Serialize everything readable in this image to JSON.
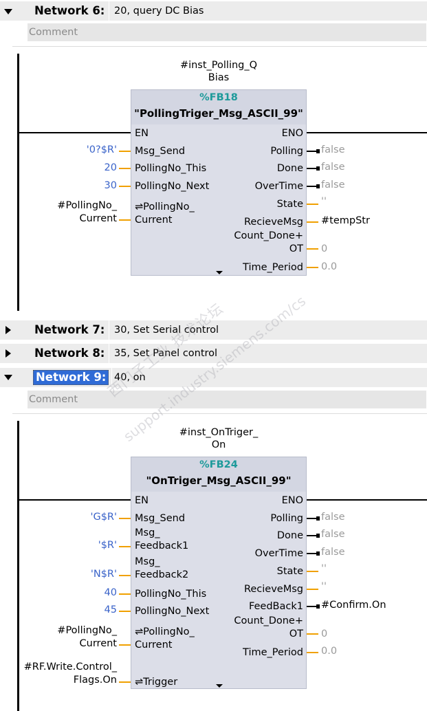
{
  "networks": [
    {
      "title": "Network 6:",
      "desc": "20, query DC Bias",
      "comment": "Comment"
    },
    {
      "title": "Network 7:",
      "desc": "30, Set Serial  control"
    },
    {
      "title": "Network 8:",
      "desc": "35, Set Panel control"
    },
    {
      "title": "Network 9:",
      "desc": "40, on",
      "comment": "Comment"
    }
  ],
  "fb1": {
    "inst_line1": "#inst_Polling_Q",
    "inst_line2": "Bias",
    "number": "%FB18",
    "name": "\"PollingTriger_Msg_ASCII_99\"",
    "in_en": "EN",
    "in_msg_send": "Msg_Send",
    "in_this": "PollingNo_This",
    "in_next": "PollingNo_Next",
    "in_cur1": "⇌PollingNo_",
    "in_cur2": "Current",
    "out_eno": "ENO",
    "out_polling": "Polling",
    "out_done": "Done",
    "out_overtime": "OverTime",
    "out_state": "State",
    "out_recieve": "RecieveMsg",
    "out_count1": "Count_Done+",
    "out_count2": "OT",
    "out_time": "Time_Period",
    "v_msg_send": "'0?$R'",
    "v_this": "20",
    "v_next": "30",
    "v_cur1": "#PollingNo_",
    "v_cur2": "Current",
    "v_polling": "false",
    "v_done": "false",
    "v_overtime": "false",
    "v_state": "''",
    "v_recieve": "#tempStr",
    "v_count": "0",
    "v_time": "0.0"
  },
  "fb2": {
    "inst_line1": "#inst_OnTriger_",
    "inst_line2": "On",
    "number": "%FB24",
    "name": "\"OnTriger_Msg_ASCII_99\"",
    "in_en": "EN",
    "in_msg_send": "Msg_Send",
    "in_fb1a": "Msg_",
    "in_fb1b": "Feedback1",
    "in_fb2a": "Msg_",
    "in_fb2b": "Feedback2",
    "in_this": "PollingNo_This",
    "in_next": "PollingNo_Next",
    "in_cur1": "⇌PollingNo_",
    "in_cur2": "Current",
    "in_trigger": "⇌Trigger",
    "out_eno": "ENO",
    "out_polling": "Polling",
    "out_done": "Done",
    "out_overtime": "OverTime",
    "out_state": "State",
    "out_recieve": "RecieveMsg",
    "out_feedback1": "FeedBack1",
    "out_count1": "Count_Done+",
    "out_count2": "OT",
    "out_time": "Time_Period",
    "v_msg_send": "'G$R'",
    "v_fb1": "'$R'",
    "v_fb2": "'N$R'",
    "v_this": "40",
    "v_next": "45",
    "v_cur1": "#PollingNo_",
    "v_cur2": "Current",
    "v_trig1": "#RF.Write.Control_",
    "v_trig2": "Flags.On",
    "v_polling": "false",
    "v_done": "false",
    "v_overtime": "false",
    "v_state": "''",
    "v_recieve": "''",
    "v_feedback1": "#Confirm.On",
    "v_count": "0",
    "v_time": "0.0"
  },
  "watermark": {
    "line1": "西门子工业 技术论坛",
    "line2": "support.industry.siemens.com/cs"
  }
}
